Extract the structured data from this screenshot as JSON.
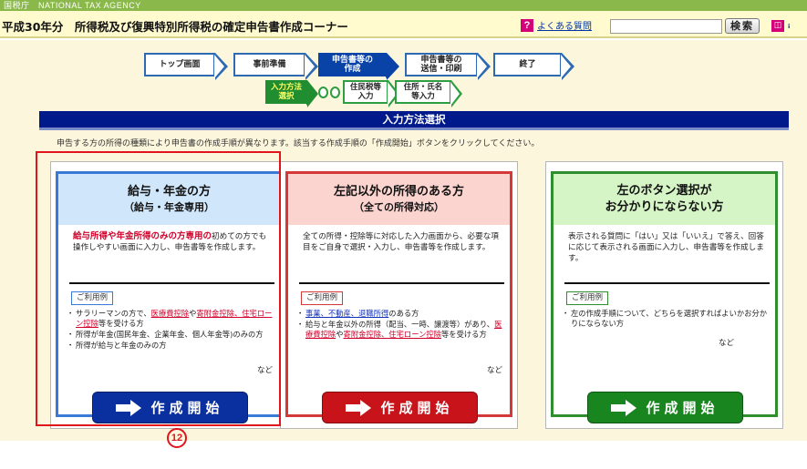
{
  "header": {
    "agency_text": "国税庁　NATIONAL TAX AGENCY",
    "title": "平成30年分　所得税及び復興特別所得税の確定申告書作成コーナー",
    "faq_icon": "?",
    "faq_label": "よくある質問",
    "search_placeholder": "",
    "search_button": "検索",
    "book_icon": "◫",
    "tail_text": "ᵢ"
  },
  "steps": [
    {
      "label": "トップ画面",
      "active": false
    },
    {
      "label": "事前準備",
      "active": false
    },
    {
      "label": "申告書等の\n作成",
      "active": true
    },
    {
      "label": "申告書等の\n送信・印刷",
      "active": false
    },
    {
      "label": "終了",
      "active": false
    }
  ],
  "substeps": [
    {
      "label": "入力方法\n選択",
      "active": true
    },
    {
      "label": "住民税等\n入力",
      "active": false
    },
    {
      "label": "住所・氏名\n等入力",
      "active": false
    }
  ],
  "section_title": "入力方法選択",
  "instruction": "申告する方の所得の種類により申告書の作成手順が異なります。該当する作成手順の「作成開始」ボタンをクリックしてください。",
  "cards": [
    {
      "title": "給与・年金の方",
      "subtitle": "（給与・年金専用）",
      "desc_em": "給与所得や年金所得のみの方専用の",
      "desc": "初めての方でも操作しやすい画面に入力し、申告書等を作成します。",
      "usage_label": "ご利用例",
      "usage_items": [
        {
          "pre": "サラリーマンの方で、",
          "hl1": "医療費控除",
          "mid1": "や",
          "hl2": "寄附金控除、住宅ローン控除",
          "post": "等を受ける方"
        },
        {
          "pre": "所得が年金(国民年金、企業年金、個人年金等)のみの方",
          "hl1": "",
          "mid1": "",
          "hl2": "",
          "post": ""
        },
        {
          "pre": "所得が給与と年金のみの方",
          "hl1": "",
          "mid1": "",
          "hl2": "",
          "post": ""
        }
      ],
      "etc": "など",
      "button": "作成開始"
    },
    {
      "title": "左記以外の所得のある方",
      "subtitle": "（全ての所得対応）",
      "desc_em": "",
      "desc": "全ての所得・控除等に対応した入力画面から、必要な項目をご自身で選択・入力し、申告書等を作成します。",
      "usage_label": "ご利用例",
      "usage_items": [
        {
          "pre": "",
          "hl1": "事業、不動産、退職所得",
          "mid1": "のある方",
          "hl2": "",
          "post": ""
        },
        {
          "pre": "給与と年金以外の所得（配当、一時、譲渡等）があり、",
          "hl1": "医療費控除",
          "mid1": "や",
          "hl2": "寄附金控除、住宅ローン控除",
          "post": "等を受ける方"
        }
      ],
      "etc": "など",
      "button": "作成開始"
    },
    {
      "title": "左のボタン選択が",
      "subtitle": "お分かりにならない方",
      "desc_em": "",
      "desc": "表示される質問に「はい」又は「いいえ」で答え、回答に応じて表示される画面に入力し、申告書等を作成します。",
      "usage_label": "ご利用例",
      "usage_items": [
        {
          "pre": "左の作成手順について、どちらを選択すればよいかお分かりにならない方",
          "hl1": "",
          "mid1": "",
          "hl2": "",
          "post": ""
        }
      ],
      "etc": "など",
      "button": "作成開始"
    }
  ],
  "annotation_number": "12",
  "colors": {
    "agency_bar": "#8ab84a",
    "title_bar": "#fffbcf",
    "main_bg": "#fcf6dc",
    "step_border": "#2e6ab1",
    "step_active": "#0a43a8",
    "substep_border": "#2e9e42",
    "section_bar": "#001a8c",
    "card1_border": "#3a79d6",
    "card1_head": "#cfe6fb",
    "card1_button": "#0a2f9f",
    "card2_border": "#d53838",
    "card2_head": "#fbd4d0",
    "card2_button": "#c8131b",
    "card3_border": "#2f8f2f",
    "card3_head": "#d6f5c6",
    "card3_button": "#18851f",
    "annotation": "#e0141a"
  }
}
